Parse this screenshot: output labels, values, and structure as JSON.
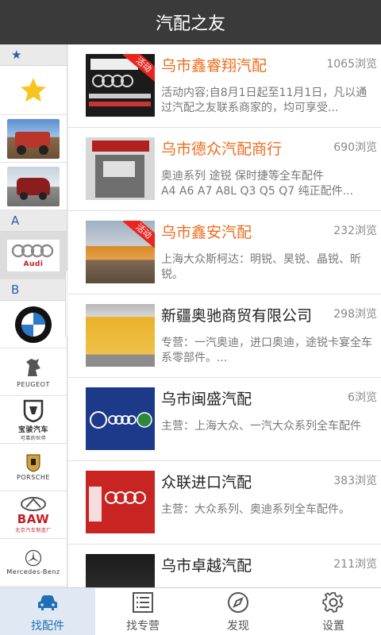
{
  "header": {
    "title": "汽配之友"
  },
  "sidebar": {
    "star_header": "★",
    "letters": [
      "A",
      "B"
    ],
    "brand_labels": {
      "audi": "Audi",
      "peugeot": "PEUGEOT",
      "baojun": "宝骏汽车",
      "baojun_sub": "可靠的伙伴",
      "porsche": "PORSCHE",
      "baw": "BAW",
      "baw_sub": "北京汽车制造厂",
      "mercedes": "Mercedes-Benz"
    }
  },
  "listings": [
    {
      "title": "乌市鑫睿翔汽配",
      "views": "1065浏览",
      "desc": "活动内容;自8月1日起至11月1日，凡以通过汽配之友联系商家的，均可享受...",
      "title_color": "orange",
      "badge": "活动"
    },
    {
      "title": "乌市德众汽配商行",
      "views": "690浏览",
      "desc": "奥迪系列  途锐  保时捷等全车配件\nA4 A6 A7 A8L Q3 Q5 Q7  纯正配件...",
      "title_color": "orange",
      "badge": ""
    },
    {
      "title": "乌市鑫安汽配",
      "views": "232浏览",
      "desc": "上海大众斯柯达：明锐、昊锐、晶锐、昕锐。",
      "title_color": "orange",
      "badge": "活动"
    },
    {
      "title": "新疆奥驰商贸有限公司",
      "views": "298浏览",
      "desc": "专营：一汽奥迪，进口奥迪，途锐卡宴全车系零部件。...",
      "title_color": "normal",
      "badge": ""
    },
    {
      "title": "乌市闽盛汽配",
      "views": "6浏览",
      "desc": "主营：上海大众、一汽大众系列全车配件",
      "title_color": "normal",
      "badge": ""
    },
    {
      "title": "众联进口汽配",
      "views": "383浏览",
      "desc": "主营：大众系列、奥迪系列全车配件。",
      "title_color": "normal",
      "badge": ""
    },
    {
      "title": "乌市卓越汽配",
      "views": "211浏览",
      "desc": "",
      "title_color": "normal",
      "badge": ""
    }
  ],
  "tabs": [
    {
      "label": "找配件",
      "icon": "car-icon",
      "active": true
    },
    {
      "label": "找专营",
      "icon": "list-icon",
      "active": false
    },
    {
      "label": "发现",
      "icon": "compass-icon",
      "active": false
    },
    {
      "label": "设置",
      "icon": "gear-icon",
      "active": false
    }
  ],
  "colors": {
    "accent": "#1f6fb8",
    "orange": "#ee6c1c",
    "header": "#3a3a3a",
    "badge": "#e8261f"
  }
}
